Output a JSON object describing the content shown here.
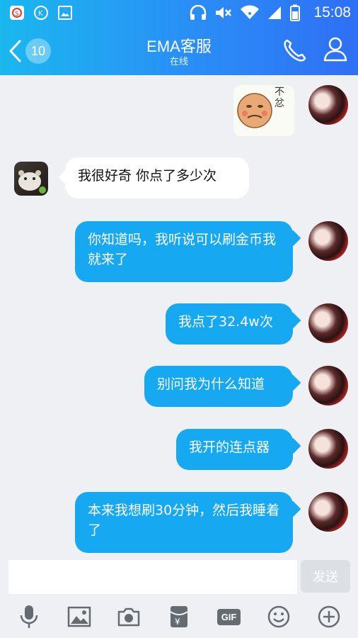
{
  "status_bar": {
    "time": "15:08"
  },
  "header": {
    "title": "EMA客服",
    "subtitle": "在线",
    "back_badge": "10"
  },
  "sticker": {
    "text": "不忿"
  },
  "messages": [
    {
      "from": "them",
      "text": "我很好奇 你点了多少次"
    },
    {
      "from": "me",
      "text": "你知道吗，我听说可以刷金币我就来了"
    },
    {
      "from": "me",
      "text": "我点了32.4w次"
    },
    {
      "from": "me",
      "text": "别问我为什么知道"
    },
    {
      "from": "me",
      "text": "我开的连点器"
    },
    {
      "from": "me",
      "text": "本来我想刷30分钟，然后我睡着了"
    }
  ],
  "input": {
    "placeholder": "",
    "send_label": "发送"
  },
  "toolbar": {
    "gif_label": "GIF",
    "icons": [
      "mic-icon",
      "image-icon",
      "camera-icon",
      "red-packet-icon",
      "gif-icon",
      "emoji-icon",
      "plus-icon"
    ]
  },
  "colors": {
    "header_start": "#1ab8ef",
    "header_end": "#2f6ff5",
    "bubble_out": "#17a8f2",
    "bubble_in": "#ffffff",
    "background": "#eef0f3"
  }
}
